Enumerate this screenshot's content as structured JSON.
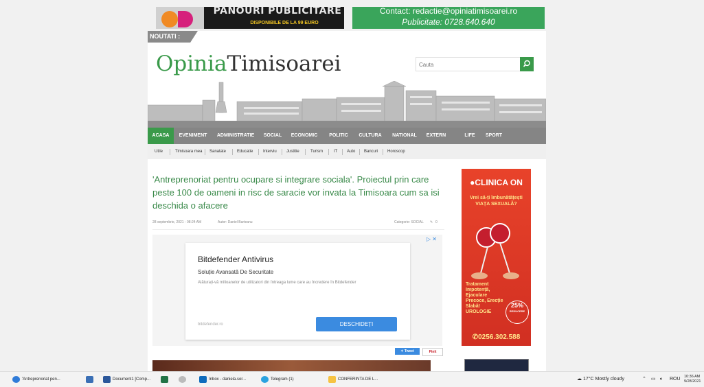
{
  "ads": {
    "panouri_title": "PANOURI PUBLICITARE",
    "panouri_sub": "DISPONIBILE DE LA 99 EURO",
    "contact_line": "Contact: redactie@opiniatimisoarei.ro",
    "publicitate_line": "Publicitate: 0728.640.640"
  },
  "noutati": "NOUTATI :",
  "logo": {
    "first": "Opinia",
    "second": "Timisoarei"
  },
  "search": {
    "placeholder": "Cauta"
  },
  "main_nav": [
    "ACASA",
    "EVENIMENT",
    "ADMINISTRATIE",
    "SOCIAL",
    "ECONOMIC",
    "POLITIC",
    "CULTURA",
    "NATIONAL",
    "EXTERN",
    "LIFE",
    "SPORT"
  ],
  "sub_nav": [
    "Utile",
    "Timisoara mea",
    "Sanatate",
    "Educatie",
    "Interviu",
    "Justitie",
    "Turism",
    "IT",
    "Auto",
    "Bancuri",
    "Horoscop"
  ],
  "article": {
    "title": "'Antreprenoriat pentru ocupare si integrare sociala'. Proiectul prin care peste 100 de oameni in risc de saracie vor invata la Timisoara cum sa isi deschida o afacere",
    "date": "28 septembrie, 2021 - 08:24 AM",
    "author": "Autor: Daniel Barteanu",
    "category": "Categorie: SOCIAL",
    "comments": "0"
  },
  "inline_ad": {
    "headline": "Bitdefender Antivirus",
    "subline": "Soluție Avansată De Securitate",
    "description": "Alăturați-vă milioanelor de utilizatori din întreaga lume care au încredere în Bitdefender",
    "domain": "bitdefender.ro",
    "button": "DESCHIDEȚI"
  },
  "share": {
    "tweet": "Tweet",
    "pinit": "Pinit"
  },
  "side_ad": {
    "brand": "CLINICA ON",
    "tagline": "Vrei să-ți îmbunătățești VIAȚA SEXUALĂ?",
    "body": "Tratament Impotență, Ejaculare Precoce, Erecție Slabă!",
    "specialty": "UROLOGIE",
    "discount": "25%",
    "discount_label": "REDUCERE",
    "phone": "0256.302.588"
  },
  "taskbar": {
    "tasks": [
      "'Antreprenoriat pen...",
      "Document1 [Comp...",
      "Inbox - daniela.sor...",
      "Telegram (1)",
      "CONFERINTA DE L..."
    ],
    "weather": "17°C  Mostly cloudy",
    "lang": "ROU",
    "time": "10:36 AM",
    "date": "9/28/2021"
  }
}
